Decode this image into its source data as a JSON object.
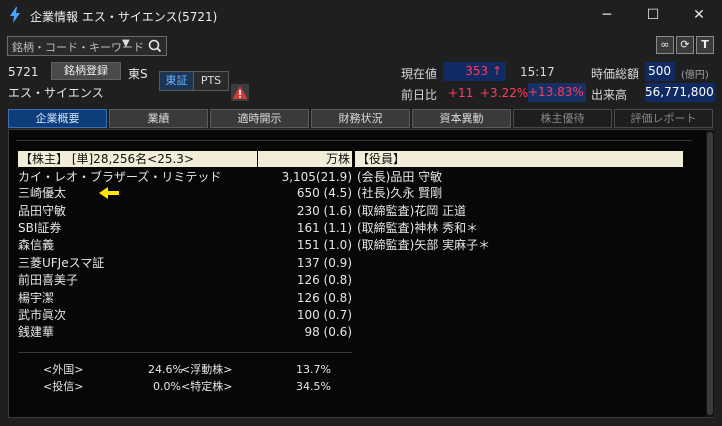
{
  "window": {
    "title": "企業情報 エス・サイエンス(5721)"
  },
  "search": {
    "placeholder": "銘柄・コード・キーワード"
  },
  "stock": {
    "code": "5721",
    "register_label": "銘柄登録",
    "market": "東S",
    "name": "エス・サイエンス",
    "exchanges": [
      "東証",
      "PTS"
    ]
  },
  "quote": {
    "price_label": "現在値",
    "price": "353",
    "price_arrow": "↑",
    "time": "15:17",
    "change_label": "前日比",
    "change": "+11",
    "change_pct": "+3.22%",
    "change_pct2": "+13.83%",
    "mcap_label": "時価総額",
    "mcap": "500",
    "mcap_unit": "(億円)",
    "volume_label": "出来高",
    "volume": "56,771,800"
  },
  "tabs": [
    {
      "label": "企業概要",
      "state": "active"
    },
    {
      "label": "業績",
      "state": "normal"
    },
    {
      "label": "適時開示",
      "state": "normal"
    },
    {
      "label": "財務状況",
      "state": "normal"
    },
    {
      "label": "資本異動",
      "state": "normal"
    },
    {
      "label": "株主優待",
      "state": "disabled"
    },
    {
      "label": "評価レポート",
      "state": "disabled"
    }
  ],
  "shareholders": {
    "header_left": "【株主】 [単]28,256名<25.3>",
    "header_right": "万株",
    "rows": [
      {
        "name": "カイ・レオ・ブラザーズ・リミテッド",
        "value": "3,105(21.9)"
      },
      {
        "name": "三崎優太",
        "value": "650 (4.5)"
      },
      {
        "name": "品田守敏",
        "value": "230 (1.6)"
      },
      {
        "name": "SBI証券",
        "value": "161 (1.1)"
      },
      {
        "name": "森信義",
        "value": "151 (1.0)"
      },
      {
        "name": "三菱UFJeスマ証",
        "value": "137 (0.9)"
      },
      {
        "name": "前田喜美子",
        "value": "126 (0.8)"
      },
      {
        "name": "楊宇潔",
        "value": "126 (0.8)"
      },
      {
        "name": "武市眞次",
        "value": "100 (0.7)"
      },
      {
        "name": "銭建華",
        "value": "98 (0.6)"
      }
    ],
    "summary": [
      {
        "label1": "<外国>",
        "value1": "24.6%",
        "label2": "<浮動株>",
        "value2": "13.7%"
      },
      {
        "label1": "<投信>",
        "value1": "0.0%",
        "label2": "<特定株>",
        "value2": "34.5%"
      }
    ]
  },
  "officers": {
    "header": "【役員】",
    "rows": [
      "(会長)品田 守敏",
      "(社長)久永 賢剛",
      "(取締監査)花岡 正道",
      "(取締監査)神林 秀和＊",
      "(取締監査)矢部 実麻子＊"
    ]
  },
  "colors": {
    "accent_red": "#ff3b5c",
    "value_box_bg": "#102a63",
    "active_tab_bg": "#0d3d7a",
    "header_bg": "#f1edd8",
    "arrow": "#ffe600"
  }
}
